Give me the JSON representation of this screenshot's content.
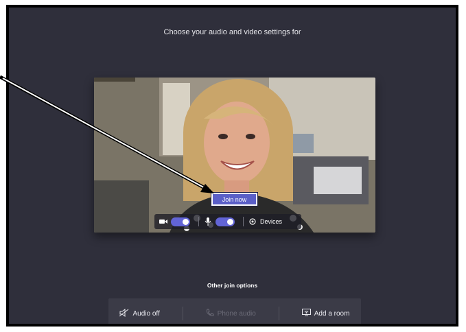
{
  "prejoin": {
    "heading": "Choose your audio and video settings for"
  },
  "preview": {
    "join_label": "Join now",
    "controls": {
      "camera_on": true,
      "mic_on": true,
      "devices_label": "Devices"
    }
  },
  "other_options": {
    "title": "Other join options",
    "items": [
      {
        "label": "Audio off",
        "icon": "speaker-off-icon",
        "enabled": true
      },
      {
        "label": "Phone audio",
        "icon": "phone-icon",
        "enabled": false
      },
      {
        "label": "Add a room",
        "icon": "cast-icon",
        "enabled": true
      }
    ]
  },
  "colors": {
    "background": "#2f2f3b",
    "accent": "#5b5fc7",
    "toggle_on": "#6264d6"
  }
}
